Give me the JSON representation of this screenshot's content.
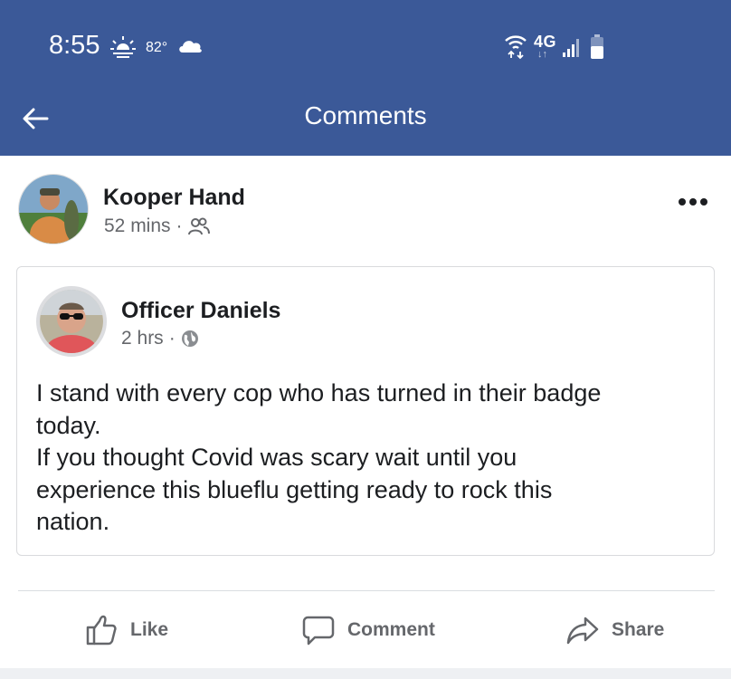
{
  "status_bar": {
    "time": "8:55",
    "temperature": "82°",
    "network": "4G",
    "icons": [
      "sun-cloud-icon",
      "cloud-icon",
      "wifi-icon",
      "signal-icon",
      "battery-icon"
    ]
  },
  "app_bar": {
    "title": "Comments",
    "back_icon": "arrow-left-icon"
  },
  "post": {
    "author": "Kooper Hand",
    "time": "52 mins",
    "separator": "·",
    "audience_icon": "friends-icon",
    "more_icon": "more-dots-icon"
  },
  "shared_post": {
    "author": "Officer Daniels",
    "time": "2 hrs",
    "separator": "·",
    "audience_icon": "globe-icon",
    "text_lines": [
      "I stand with every cop who has turned in their badge",
      "today.",
      "If you thought Covid was scary wait until you",
      "experience this blueflu getting ready to rock this",
      "nation."
    ]
  },
  "actions": {
    "like": "Like",
    "comment": "Comment",
    "share": "Share"
  },
  "colors": {
    "header": "#3b5998",
    "text": "#1c1e21",
    "muted": "#65676b",
    "border": "#d9dadd"
  }
}
